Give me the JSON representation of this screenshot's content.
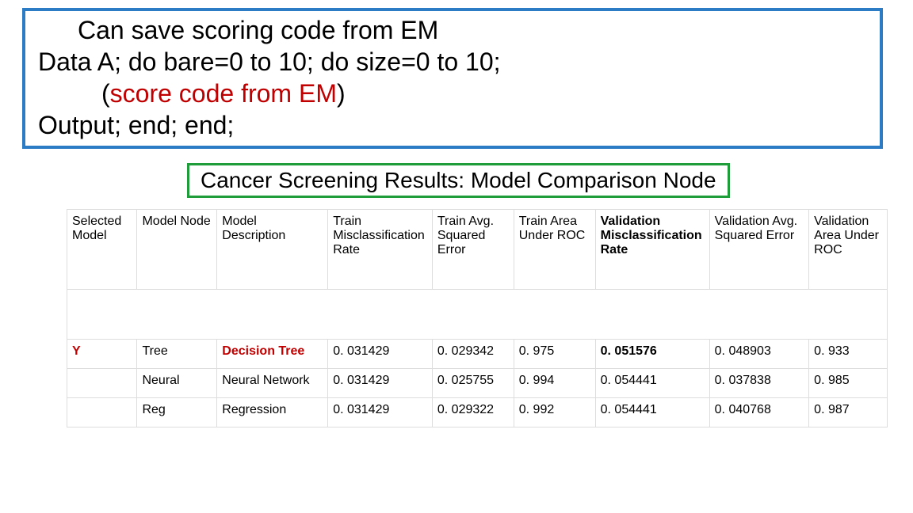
{
  "code": {
    "l1_pre": "Can save scoring code from EM",
    "l2": "Data A; do bare=0 to 10; do size=0 to 10;",
    "l3_open": "(",
    "l3_red": "score code from EM",
    "l3_close": ")",
    "l4": "Output; end; end;"
  },
  "title": "Cancer Screening Results: Model Comparison Node",
  "headers": {
    "c0": "Selected Model",
    "c1": "Model Node",
    "c2": "Model Description",
    "c3": "Train Misclassification Rate",
    "c4": "Train Avg. Squared Error",
    "c5": "Train Area Under ROC",
    "c6": "Validation Misclassification Rate",
    "c7": "Validation Avg. Squared Error",
    "c8": "Validation Area Under ROC"
  },
  "rows": [
    {
      "sel": "Y",
      "node": "Tree",
      "desc": "Decision Tree",
      "tmis": "0. 031429",
      "tavg": "0. 029342",
      "troc": "0. 975",
      "vmis": "0. 051576",
      "vavg": "0. 048903",
      "vroc": "0. 933",
      "highlight": "red"
    },
    {
      "sel": "",
      "node": "Neural",
      "desc": "Neural Network",
      "tmis": "0. 031429",
      "tavg": "0. 025755",
      "troc": "0. 994",
      "vmis": "0. 054441",
      "vavg": "0. 037838",
      "vroc": "0. 985",
      "highlight": "none"
    },
    {
      "sel": "",
      "node": "Reg",
      "desc": "Regression",
      "tmis": "0. 031429",
      "tavg": "0. 029322",
      "troc": "0. 992",
      "vmis": "0. 054441",
      "vavg": "0. 040768",
      "vroc": "0. 987",
      "highlight": "none"
    }
  ],
  "chart_data": {
    "type": "table",
    "title": "Cancer Screening Results: Model Comparison Node",
    "columns": [
      "Selected Model",
      "Model Node",
      "Model Description",
      "Train Misclassification Rate",
      "Train Avg. Squared Error",
      "Train Area Under ROC",
      "Validation Misclassification Rate",
      "Validation Avg. Squared Error",
      "Validation Area Under ROC"
    ],
    "rows": [
      [
        "Y",
        "Tree",
        "Decision Tree",
        0.031429,
        0.029342,
        0.975,
        0.051576,
        0.048903,
        0.933
      ],
      [
        "",
        "Neural",
        "Neural Network",
        0.031429,
        0.025755,
        0.994,
        0.054441,
        0.037838,
        0.985
      ],
      [
        "",
        "Reg",
        "Regression",
        0.031429,
        0.029322,
        0.992,
        0.054441,
        0.040768,
        0.987
      ]
    ]
  }
}
